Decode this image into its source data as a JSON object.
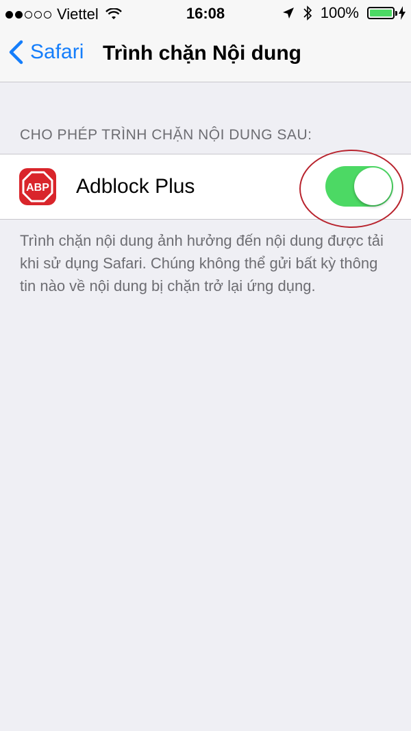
{
  "status_bar": {
    "carrier": "Viettel",
    "time": "16:08",
    "battery": "100%",
    "signal_bars_filled": 2,
    "signal_bars_total": 5
  },
  "nav": {
    "back_label": "Safari",
    "title": "Trình chặn Nội dung"
  },
  "section": {
    "header": "CHO PHÉP TRÌNH CHẶN NỘI DUNG SAU:",
    "items": [
      {
        "icon": "adblock-plus-icon",
        "icon_text": "ABP",
        "label": "Adblock Plus",
        "enabled": true
      }
    ]
  },
  "footer": "Trình chặn nội dung ảnh hưởng đến nội dung được tải khi sử dụng Safari. Chúng không thể gửi bất kỳ thông tin nào về nội dung bị chặn trở lại ứng dụng.",
  "colors": {
    "accent": "#157efb",
    "toggle_on": "#4cd964",
    "abp_red": "#d9252b",
    "annotation": "#b8232d"
  }
}
